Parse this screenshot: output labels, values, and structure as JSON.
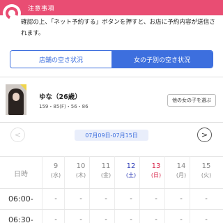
{
  "notice": {
    "title": "注意事項",
    "text": "確認の上、「ネット予約する」ボタンを押すと、お店に予約内容が送信されます。"
  },
  "tabs": {
    "store": "店舗の空き状況",
    "girl": "女の子別の空き状況"
  },
  "girl": {
    "name": "ゆな（26歳）",
    "stats": "159・85(F)・56・86",
    "other_button": "他の女の子を選ぶ"
  },
  "date_nav": {
    "prev": "<",
    "range": "07月09日-07月15日",
    "next": ">"
  },
  "schedule": {
    "header_label": "日時",
    "days": [
      {
        "num": "9",
        "wd": "(水)"
      },
      {
        "num": "10",
        "wd": "(木)"
      },
      {
        "num": "11",
        "wd": "(金)"
      },
      {
        "num": "12",
        "wd": "(土)"
      },
      {
        "num": "13",
        "wd": "(日)"
      },
      {
        "num": "14",
        "wd": "(月)"
      },
      {
        "num": "15",
        "wd": "(火)"
      }
    ],
    "rows": [
      {
        "time": "06:00-",
        "cells": [
          "-",
          "-",
          "-",
          "-",
          "-",
          "-",
          "-"
        ]
      },
      {
        "time": "06:30-",
        "cells": [
          "-",
          "-",
          "-",
          "-",
          "-",
          "-",
          "-"
        ]
      }
    ]
  }
}
